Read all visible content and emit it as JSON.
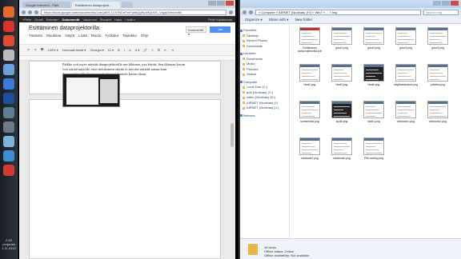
{
  "taskbar": {
    "clock": [
      "2:45",
      "perjantai",
      "2.11.2012"
    ],
    "icon_colors": [
      "#e36b2c",
      "#d8322a",
      "#e04a2f",
      "#bcbcbc",
      "#6aa1d8",
      "#3b7bd6",
      "#1d4f9c",
      "#5e7d92",
      "#6e7a86",
      "#7fb2dd",
      "#3c8fd1",
      "#d23a35"
    ]
  },
  "chrome": {
    "tabs": [
      "Google Kalenteri - Pääl",
      "Esittäminen dataprojekt...",
      ""
    ],
    "url": "https://docs.google.com/document/d/1oeQaE0-1ChTNDeFerFpIlbQgRpd9QtXlS--VlgqDWeI/edit#",
    "gbar": {
      "items": [
        "+Pelle",
        "Gmail",
        "Kalenteri",
        "Dokumentit",
        "Valokuvat",
        "Sivustot",
        "Haku",
        "Lisää »"
      ],
      "active_index": 3,
      "user": "Pelle Kaiutinman"
    },
    "doc": {
      "title": "Esittäminen dataprojektorilla",
      "star": "☆",
      "menus": [
        "Tiedosto",
        "Muokkaa",
        "Näytä",
        "Lisää",
        "Muoto",
        "Työkalut",
        "Taulukko",
        "Ohje"
      ],
      "comments_label": "Kommentit ▾",
      "share_label": "Jaa",
      "toolbar": [
        "↶",
        "↷",
        "🖶",
        "100% ▾",
        "Normaali teksti ▾",
        "Georgia ▾",
        "11 ▾",
        "B",
        "I",
        "U",
        "A ▾",
        "🔗",
        "≡",
        "☰",
        "⇤",
        "⇥"
      ],
      "paragraph": "Paikko voit myös näyttää dataprojektorilla sen ikkunan, jota käytät. Sen ikkunan kuvan voit siirtää näytölle, ettei tietokoneen näyttö ei tarvitse näyttää samaa kuin dataprojektorilla. Laajennus kytkin tai Jaottele kuvan tilaan."
    }
  },
  "explorer": {
    "path": "« Computer » AIRNET (\\\\kotinas) (H:) » Win7 » ... » img",
    "search_placeholder": "Search img",
    "commands": [
      "Organize ▾",
      "Share with ▾",
      "New folder"
    ],
    "nav": [
      {
        "label": "Favorites",
        "head": true
      },
      {
        "label": "Desktop",
        "head": false
      },
      {
        "label": "Recent Places",
        "head": false
      },
      {
        "label": "Downloads",
        "head": false
      },
      {
        "label": "Libraries",
        "head": true
      },
      {
        "label": "Documents",
        "head": false
      },
      {
        "label": "Music",
        "head": false
      },
      {
        "label": "Pictures",
        "head": false
      },
      {
        "label": "Videos",
        "head": false
      },
      {
        "label": "Computer",
        "head": true
      },
      {
        "label": "Local Disk (C:)",
        "head": false
      },
      {
        "label": "pub (\\\\kotinas) (G:)",
        "head": false
      },
      {
        "label": "video (\\\\kotinas) (H:)",
        "head": false
      },
      {
        "label": "AIRNET (\\\\kotinas) (I:)",
        "head": false
      },
      {
        "label": "AIRNET (\\\\kotinas) (J:)",
        "head": false
      },
      {
        "label": "Network",
        "head": true
      }
    ],
    "files": [
      {
        "name": "Esittäminen dataprojektorilla.pdf",
        "kind": "pdf"
      },
      {
        "name": "gdoc1.png",
        "kind": "png"
      },
      {
        "name": "gdoc2.png",
        "kind": "png"
      },
      {
        "name": "gdoc3.png",
        "kind": "png"
      },
      {
        "name": "gdoc4.png",
        "kind": "png"
      },
      {
        "name": "hlaa2.png",
        "kind": "png"
      },
      {
        "name": "hlaa3.png",
        "kind": "png"
      },
      {
        "name": "hlaab.png",
        "kind": "dark"
      },
      {
        "name": "näyttöasetukset.png",
        "kind": "png"
      },
      {
        "name": "pdfview.png",
        "kind": "png"
      },
      {
        "name": "screenread.png",
        "kind": "png"
      },
      {
        "name": "slyde.png",
        "kind": "dark"
      },
      {
        "name": "slide1.png",
        "kind": "png"
      },
      {
        "name": "windows1.png",
        "kind": "png"
      },
      {
        "name": "windows2.png",
        "kind": "png"
      },
      {
        "name": "windows3.png",
        "kind": "png"
      },
      {
        "name": "windowsb.png",
        "kind": "png"
      },
      {
        "name": "Piirt.overlay.png",
        "kind": "png"
      }
    ],
    "status": {
      "count": "18 items",
      "line2": "Offline status: Online",
      "line3": "Offline availability: Not available"
    }
  }
}
